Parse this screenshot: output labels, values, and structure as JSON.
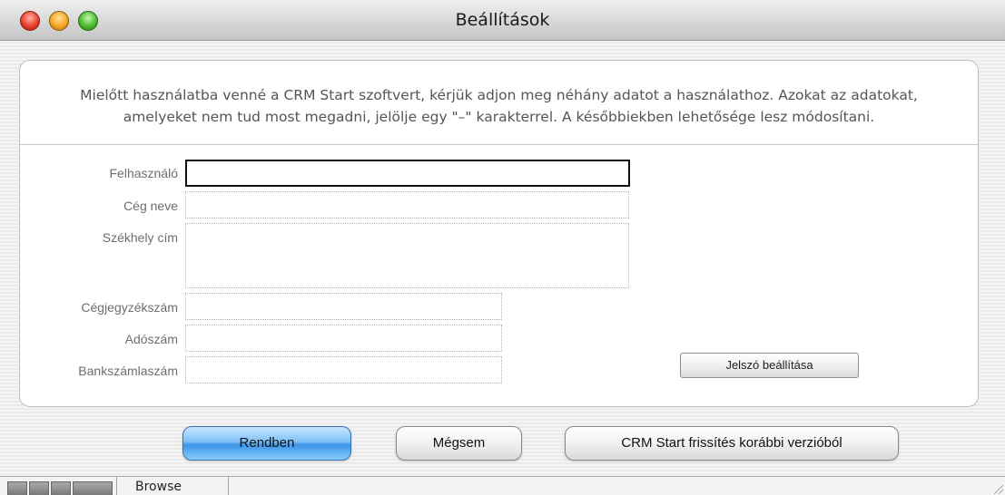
{
  "window": {
    "title": "Beállítások"
  },
  "intro": {
    "line1": "Mielőtt használatba venné a CRM Start szoftvert, kérjük adjon meg néhány adatot a használathoz. Azokat az adatokat,",
    "line2": "amelyeket nem tud most megadni, jelölje egy \"–\" karakterrel. A későbbiekben lehetősége lesz módosítani."
  },
  "form": {
    "felhasznalo": {
      "label": "Felhasználó",
      "value": ""
    },
    "ceg_neve": {
      "label": "Cég neve",
      "value": ""
    },
    "szekhely_cim": {
      "label": "Székhely cím",
      "value": ""
    },
    "cegjegyzekszam": {
      "label": "Cégjegyzékszám",
      "value": ""
    },
    "adoszam": {
      "label": "Adószám",
      "value": ""
    },
    "bankszamlaszam": {
      "label": "Bankszámlaszám",
      "value": ""
    }
  },
  "buttons": {
    "password": "Jelszó beállítása",
    "ok": "Rendben",
    "cancel": "Mégsem",
    "upgrade": "CRM Start frissítés korábbi verzióból"
  },
  "statusbar": {
    "mode": "Browse"
  },
  "colors": {
    "default_button": "#5aa9f0",
    "close": "#e8402c",
    "minimize": "#f5a623",
    "zoom": "#4dbb2b"
  }
}
